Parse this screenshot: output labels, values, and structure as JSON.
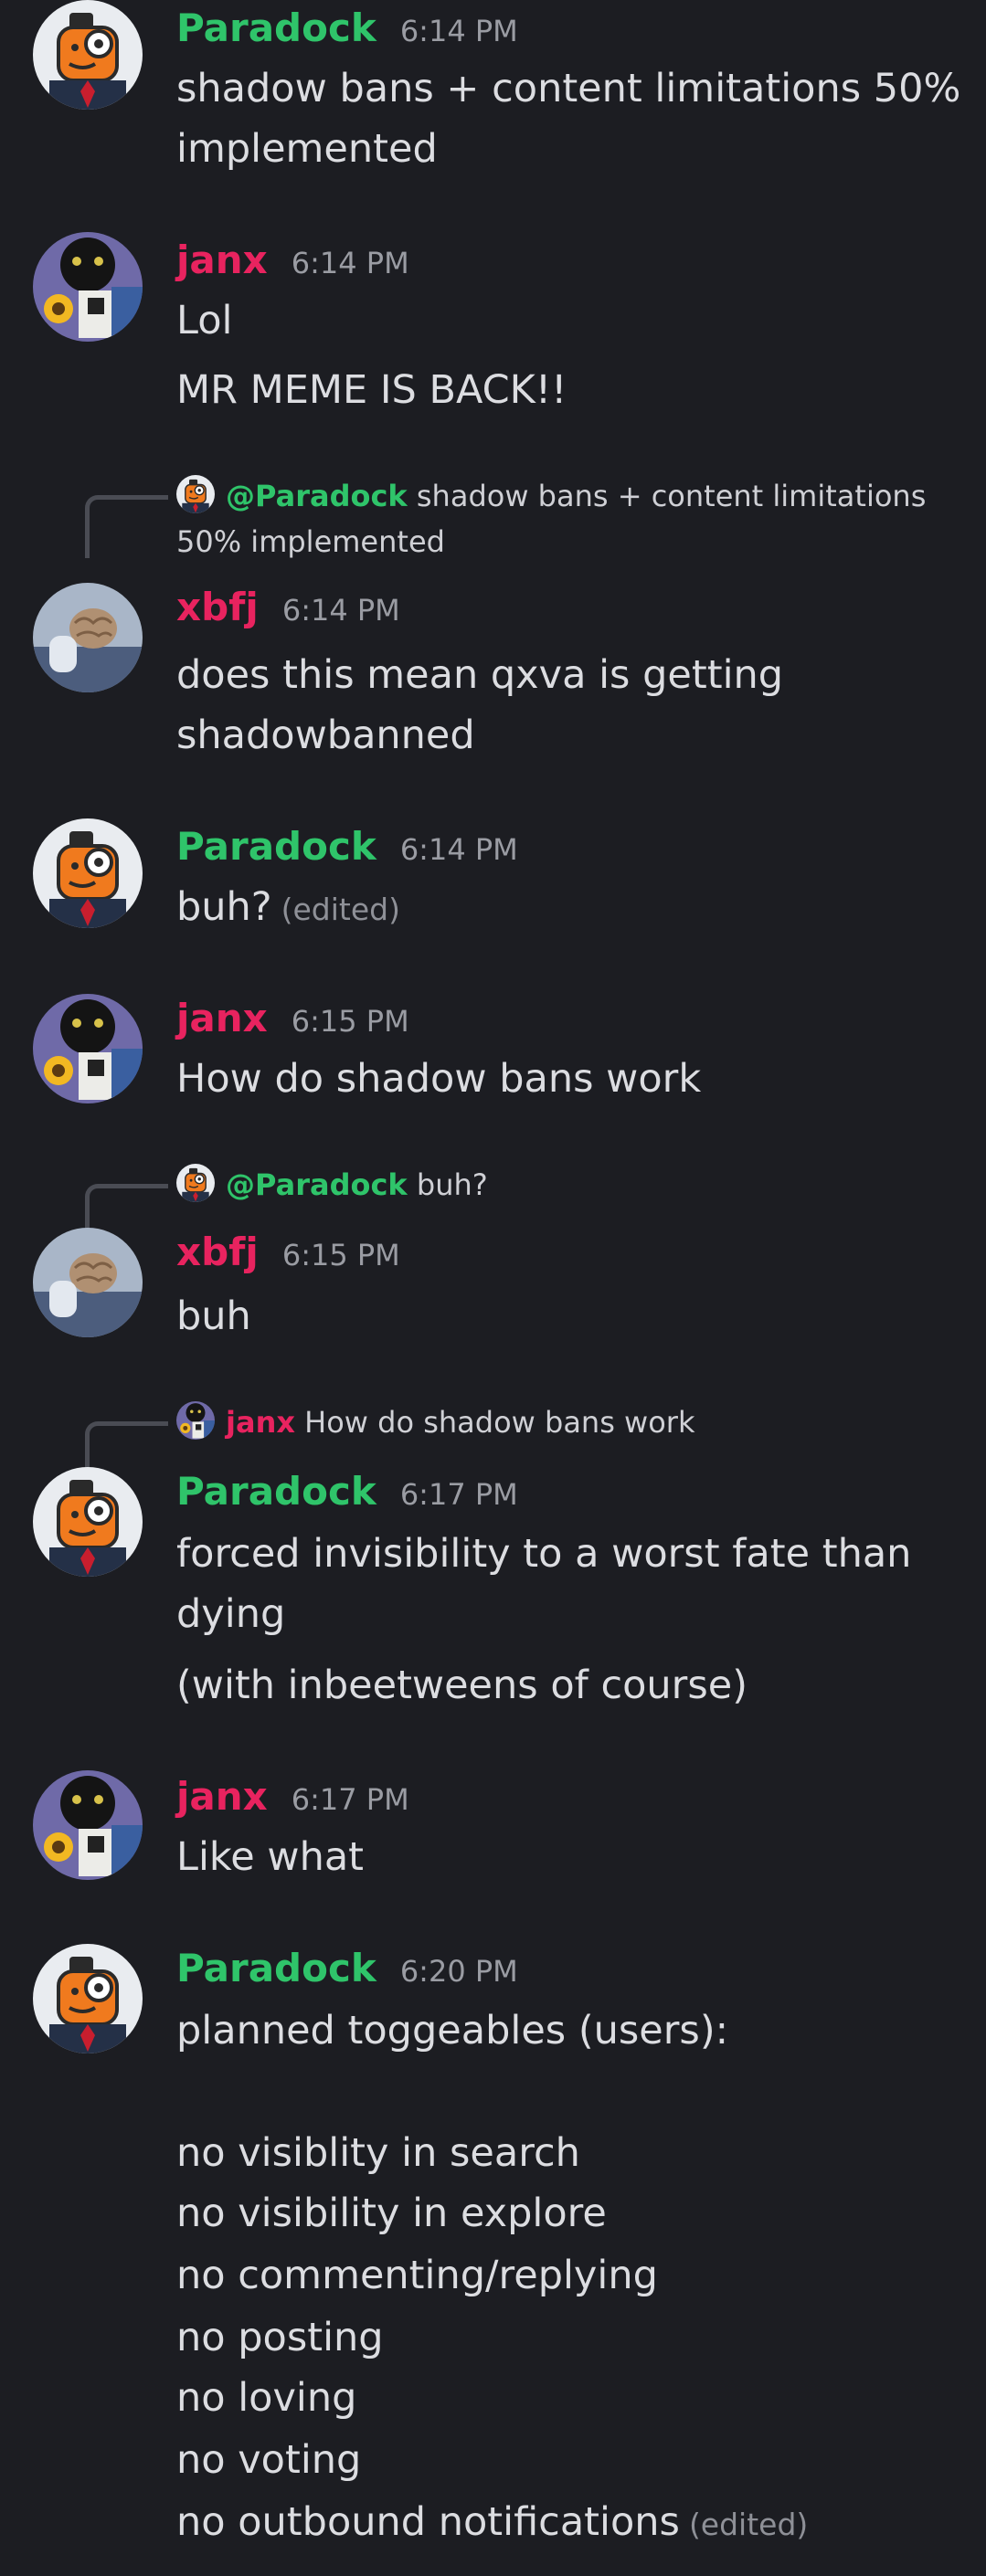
{
  "messages": {
    "m1": {
      "author": "Paradock",
      "time": "6:14 PM",
      "lines": [
        "shadow bans + content limitations 50%",
        "implemented"
      ]
    },
    "m2": {
      "author": "janx",
      "time": "6:14 PM",
      "lines": [
        "Lol",
        "MR MEME IS BACK!!"
      ]
    },
    "m3": {
      "reply_author": "@Paradock",
      "reply_text_1": "shadow bans + content limitations",
      "reply_text_2": "50% implemented",
      "author": "xbfj",
      "time": "6:14 PM",
      "lines": [
        "does this mean qxva is getting",
        "shadowbanned"
      ]
    },
    "m4": {
      "author": "Paradock",
      "time": "6:14 PM",
      "lines": [
        "buh?"
      ],
      "edited": "(edited)"
    },
    "m5": {
      "author": "janx",
      "time": "6:15 PM",
      "lines": [
        "How do shadow bans work"
      ]
    },
    "m6": {
      "reply_author": "@Paradock",
      "reply_text": "buh?",
      "author": "xbfj",
      "time": "6:15 PM",
      "lines": [
        "buh"
      ]
    },
    "m7": {
      "reply_author": "janx",
      "reply_text": "How do shadow bans work",
      "author": "Paradock",
      "time": "6:17 PM",
      "lines": [
        "forced invisibility to a worst fate than",
        "dying",
        "(with inbeetweens of course)"
      ]
    },
    "m8": {
      "author": "janx",
      "time": "6:17 PM",
      "lines": [
        "Like what"
      ]
    },
    "m9": {
      "author": "Paradock",
      "time": "6:20 PM",
      "lines": [
        "planned toggeables (users):",
        "no visiblity in search",
        "no visibility in explore",
        "no commenting/replying",
        "no posting",
        "no loving",
        "no voting",
        "no outbound notifications"
      ],
      "edited": "(edited)"
    }
  },
  "colors": {
    "background": "#1c1d22",
    "paradock": "#2fc46a",
    "janx": "#e8235f",
    "xbfj": "#e8235f",
    "timestamp": "#9a9ca3"
  },
  "icons": {
    "paradock_avatar": "orange-monocle-robot-avatar",
    "janx_avatar": "black-cat-collage-avatar",
    "xbfj_avatar": "brain-character-avatar"
  }
}
